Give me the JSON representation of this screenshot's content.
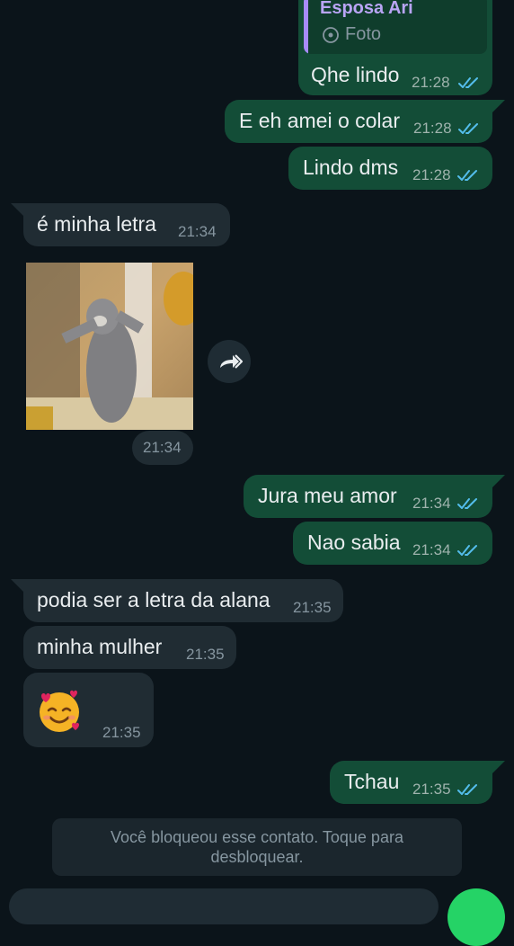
{
  "colors": {
    "background": "#0b141a",
    "outgoing_bubble": "#134d37",
    "incoming_bubble": "#202c33",
    "read_ticks": "#53bdeb",
    "quote_accent": "#a78bfa",
    "send_button": "#25d366"
  },
  "quoted_message": {
    "author": "Esposa Ari",
    "icon": "camera-icon",
    "type_label": "Foto"
  },
  "messages": [
    {
      "direction": "out",
      "text": "Qhe lindo",
      "time": "21:28",
      "status": "read"
    },
    {
      "direction": "out",
      "text": "E eh amei o colar",
      "time": "21:28",
      "status": "read"
    },
    {
      "direction": "out",
      "text": "Lindo dms",
      "time": "21:28",
      "status": "read"
    },
    {
      "direction": "in",
      "text": "é minha letra",
      "time": "21:34"
    },
    {
      "direction": "in",
      "type": "gif",
      "time": "21:34",
      "icon": "forward-icon"
    },
    {
      "direction": "out",
      "text": "Jura meu amor",
      "time": "21:34",
      "status": "read"
    },
    {
      "direction": "out",
      "text": "Nao sabia",
      "time": "21:34",
      "status": "read"
    },
    {
      "direction": "in",
      "text": "podia ser a letra da alana",
      "time": "21:35"
    },
    {
      "direction": "in",
      "text": "minha mulher",
      "time": "21:35"
    },
    {
      "direction": "in",
      "type": "emoji",
      "icon": "smiling-face-with-hearts-emoji",
      "time": "21:35"
    },
    {
      "direction": "out",
      "text": "Tchau",
      "time": "21:35",
      "status": "read"
    }
  ],
  "blocked_notice": "Você bloqueou esse contato. Toque para desbloquear."
}
